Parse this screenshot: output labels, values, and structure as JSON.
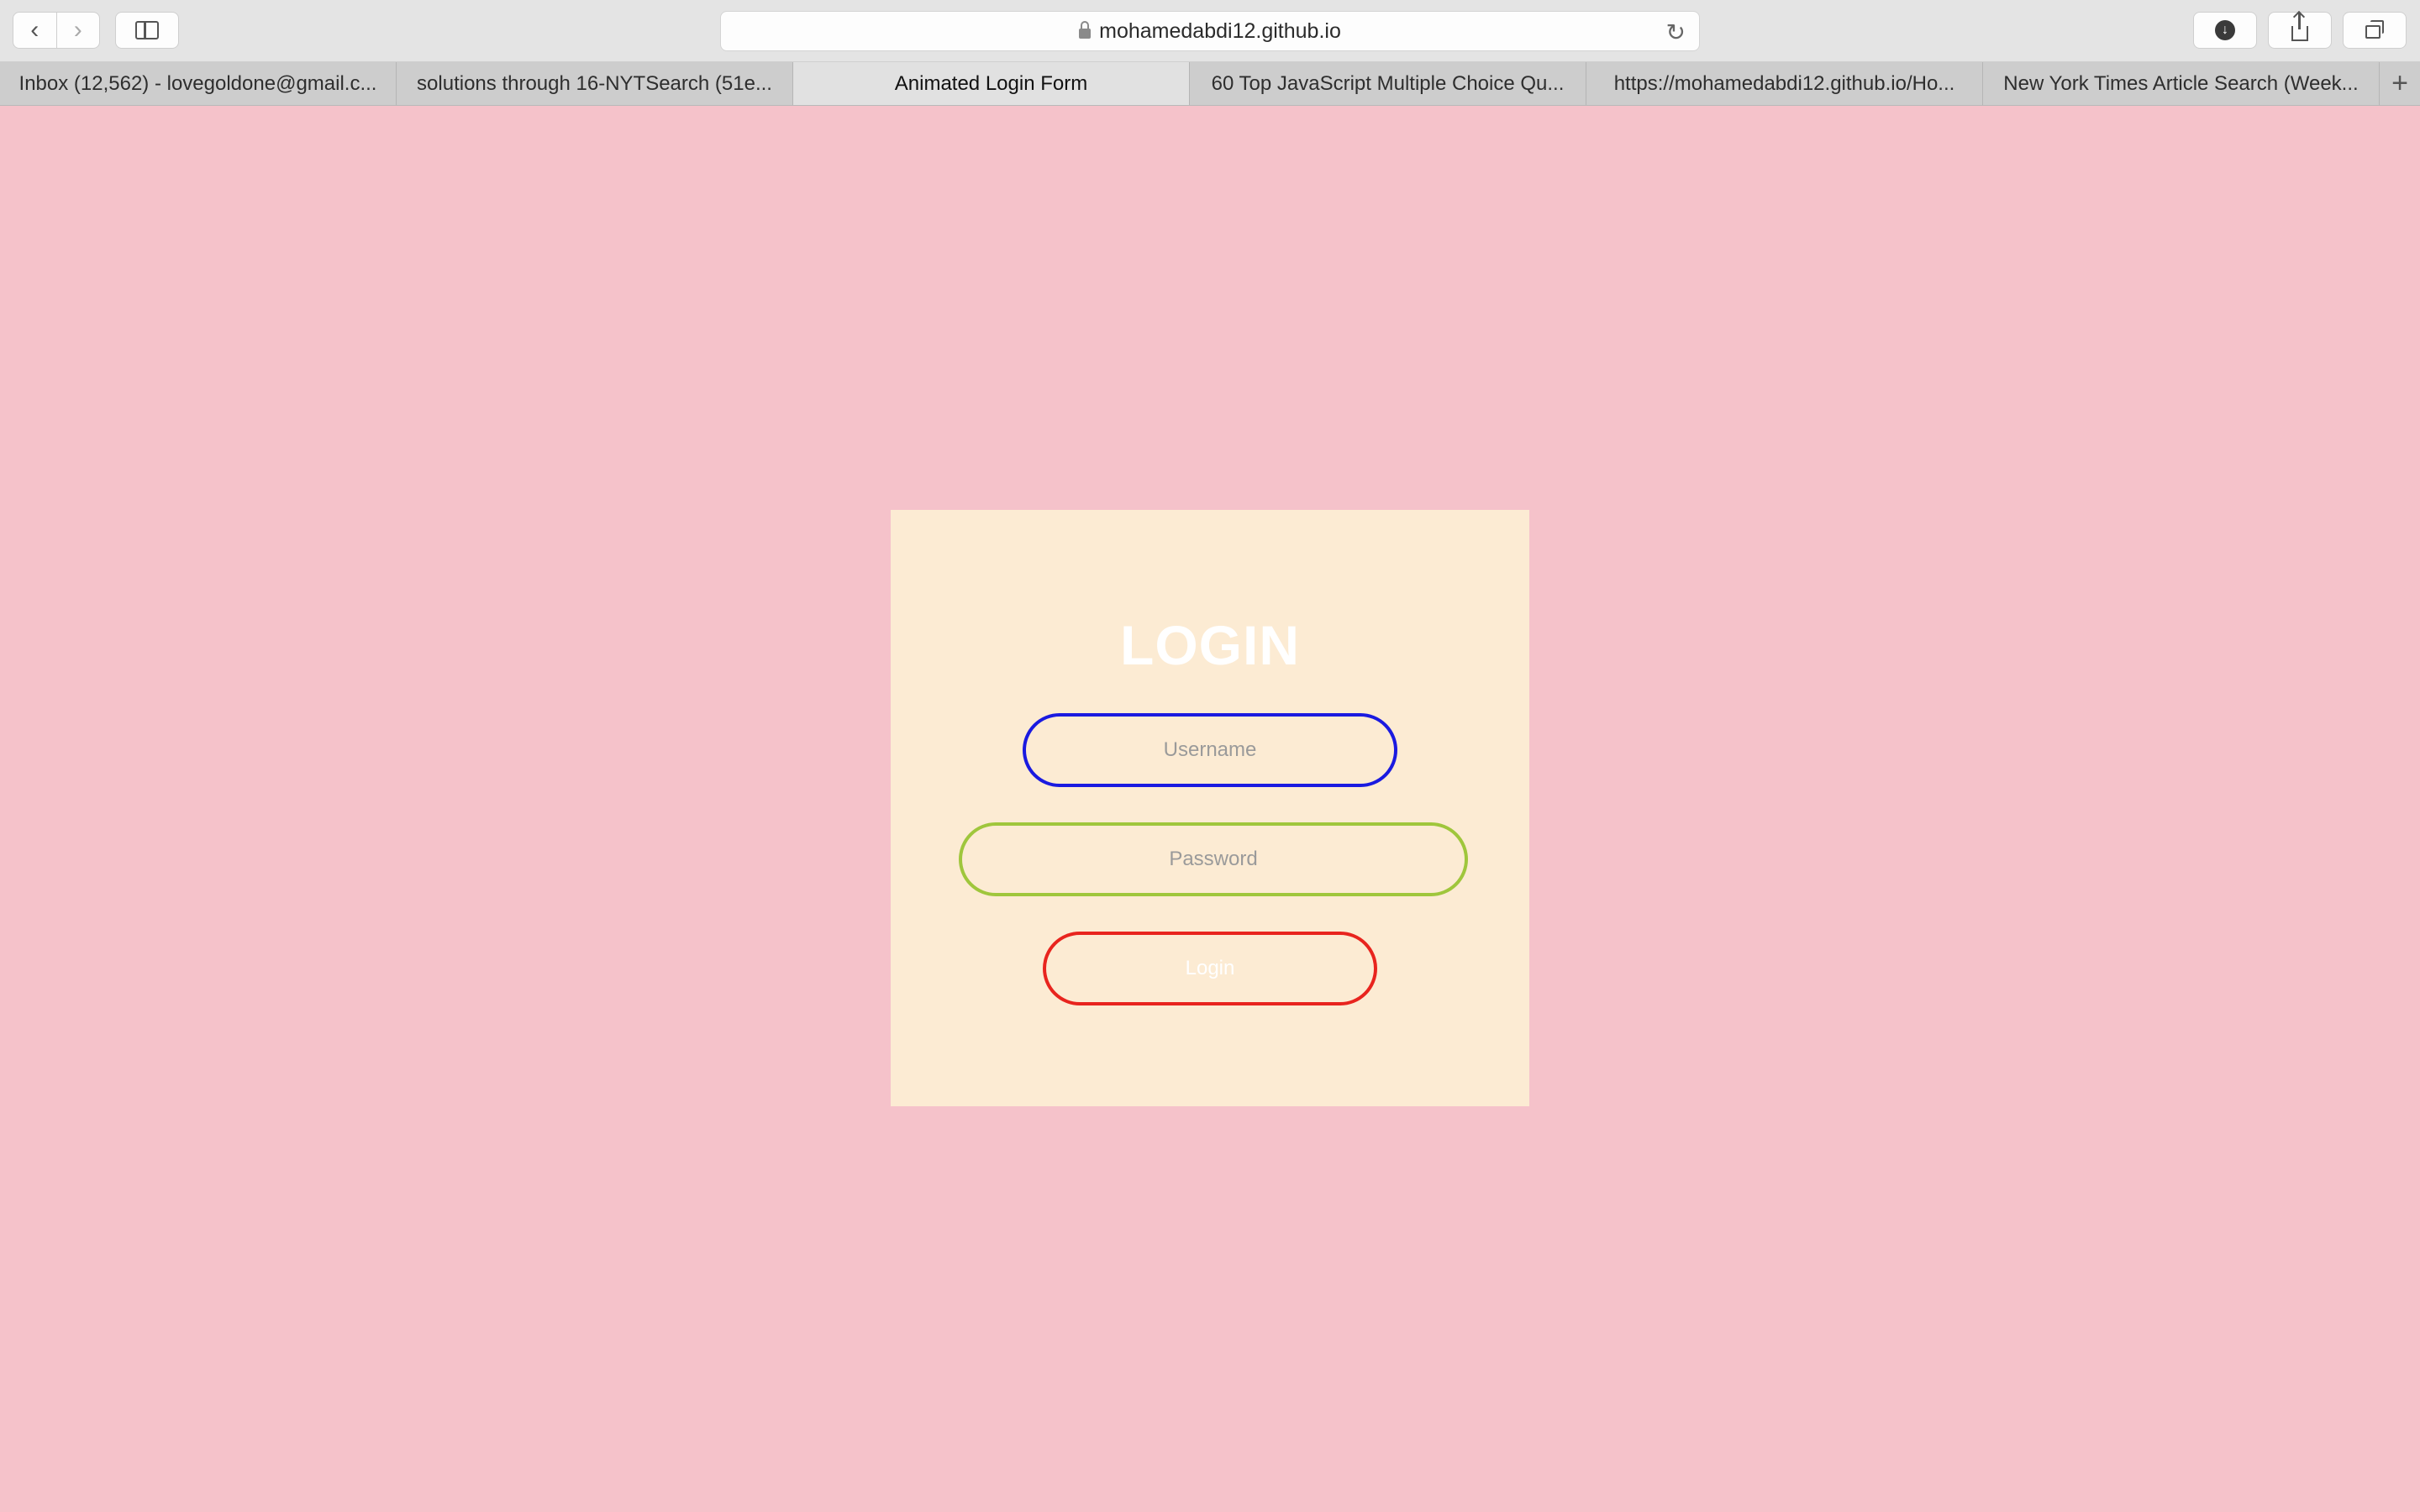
{
  "browser": {
    "url": "mohamedabdi12.github.io",
    "nav": {
      "back_icon": "chevron-left-icon",
      "forward_icon": "chevron-right-icon",
      "sidebar_icon": "sidebar-icon",
      "reload_icon": "reload-icon",
      "download_icon": "download-icon",
      "share_icon": "share-icon",
      "tabs_icon": "tab-overview-icon"
    },
    "tabs": [
      {
        "label": "Inbox (12,562) - lovegoldone@gmail.c...",
        "active": false
      },
      {
        "label": "solutions through 16-NYTSearch (51e...",
        "active": false
      },
      {
        "label": "Animated Login Form",
        "active": true
      },
      {
        "label": "60 Top JavaScript Multiple Choice Qu...",
        "active": false
      },
      {
        "label": "https://mohamedabdi12.github.io/Ho...",
        "active": false
      },
      {
        "label": "New York Times Article Search (Week...",
        "active": false
      }
    ],
    "new_tab_label": "+"
  },
  "login": {
    "title": "LOGIN",
    "username_placeholder": "Username",
    "password_placeholder": "Password",
    "button_label": "Login"
  },
  "colors": {
    "page_background": "#f5c2ca",
    "card_background": "#fcebd3",
    "username_border": "#1a1ae0",
    "password_border": "#9fc63c",
    "button_border": "#e8241e"
  }
}
